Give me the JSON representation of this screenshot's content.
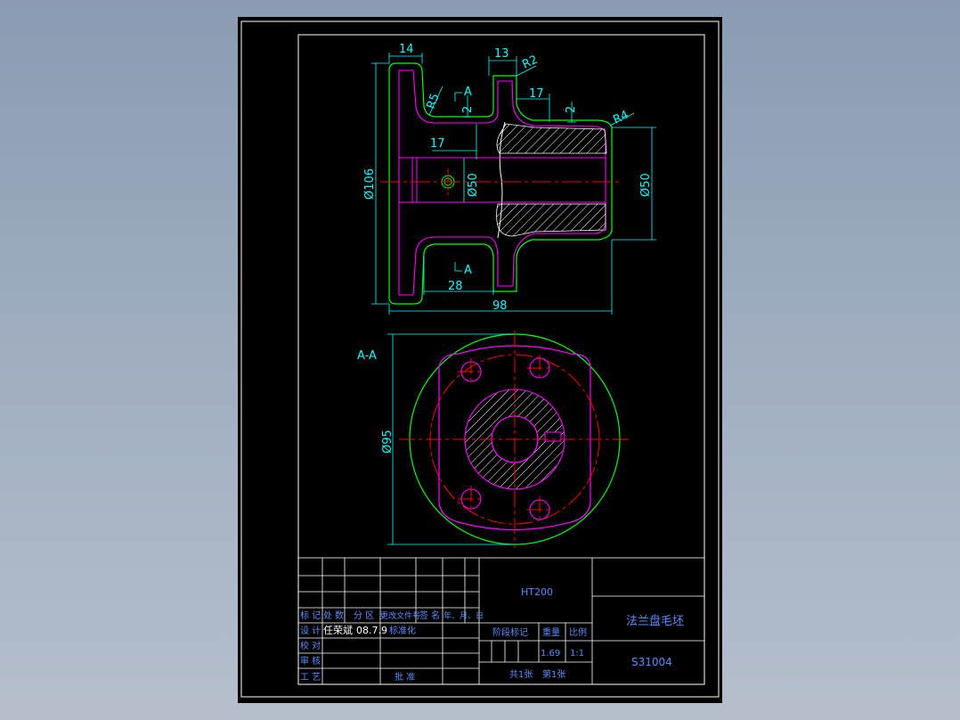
{
  "colors": {
    "background": "#000000",
    "outline": "#00ff00",
    "section": "#ff00ff",
    "dimension": "#00ffff",
    "centerline": "#ff0000",
    "frame": "#ffffff",
    "titleblock_text": "#5a8cff"
  },
  "front_view": {
    "dims": {
      "d14": "14",
      "d13": "13",
      "r2": "R2",
      "r5": "R5",
      "r4": "R4",
      "d17_top": "17",
      "d2_left": "2",
      "d2_right": "2",
      "d17_inner": "17",
      "phi106": "Ø106",
      "phi50_inner": "Ø50",
      "phi50_right": "Ø50",
      "d28": "28",
      "d98": "98"
    },
    "section_mark_top": "A",
    "section_mark_bottom": "A"
  },
  "section_view": {
    "label": "A-A",
    "phi95": "Ø95"
  },
  "title_block": {
    "material": "HT200",
    "part_name": "法兰盘毛坯",
    "drawing_no": "S31004",
    "labels": {
      "mark": "标 记",
      "count": "处 数",
      "zone": "分 区",
      "change_doc": "更改文件号",
      "signature": "签 名",
      "date": "年、月、日",
      "design": "设 计",
      "standardize": "标准化",
      "check": "校 对",
      "review": "审 核",
      "process": "工 艺",
      "approve": "批 准",
      "stage": "阶段标记",
      "weight": "重量",
      "scale": "比例",
      "sheets_total": "共1张",
      "sheet_no": "第1张"
    },
    "designer": "任荣斌",
    "design_date": "08.7.9",
    "weight": "1.69",
    "scale": "1:1"
  }
}
